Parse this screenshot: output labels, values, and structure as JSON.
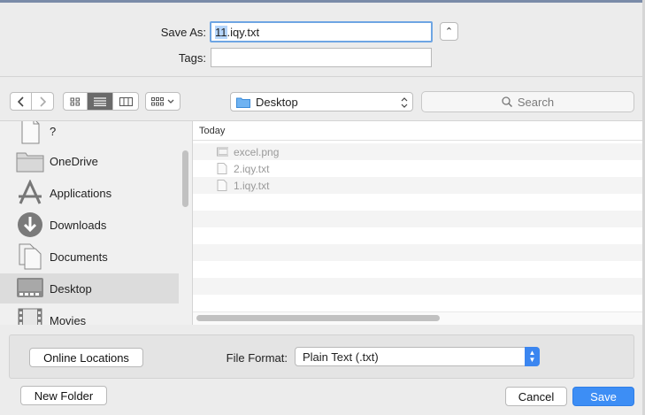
{
  "dialog": {
    "save_as_label": "Save As:",
    "save_as_selected": "11",
    "save_as_rest": ".iqy.txt",
    "tags_label": "Tags:",
    "expand_glyph": "⌃"
  },
  "toolbar": {
    "back_icon": "chevron-left-icon",
    "forward_icon": "chevron-right-icon",
    "view_modes": [
      "icon-view",
      "list-view",
      "column-view",
      "gallery-view"
    ],
    "location": "Desktop",
    "search_placeholder": "Search"
  },
  "sidebar": {
    "items": [
      {
        "label": "?",
        "icon": "document-icon"
      },
      {
        "label": "OneDrive",
        "icon": "folder-icon"
      },
      {
        "label": "Applications",
        "icon": "applications-icon"
      },
      {
        "label": "Downloads",
        "icon": "downloads-icon"
      },
      {
        "label": "Documents",
        "icon": "documents-icon"
      },
      {
        "label": "Desktop",
        "icon": "desktop-icon",
        "selected": true
      },
      {
        "label": "Movies",
        "icon": "movies-icon"
      }
    ]
  },
  "files": {
    "section_header": "Today",
    "rows": [
      {
        "name": "excel.png",
        "icon": "image-file-icon"
      },
      {
        "name": "2.iqy.txt",
        "icon": "text-file-icon"
      },
      {
        "name": "1.iqy.txt",
        "icon": "text-file-icon"
      }
    ]
  },
  "options": {
    "online_locations": "Online Locations",
    "file_format_label": "File Format:",
    "file_format_value": "Plain Text (.txt)"
  },
  "footer": {
    "new_folder": "New Folder",
    "cancel": "Cancel",
    "save": "Save"
  },
  "colors": {
    "accent": "#3d8ef5",
    "selection": "#b5d5fb",
    "focus_ring": "#6ea5e3"
  }
}
